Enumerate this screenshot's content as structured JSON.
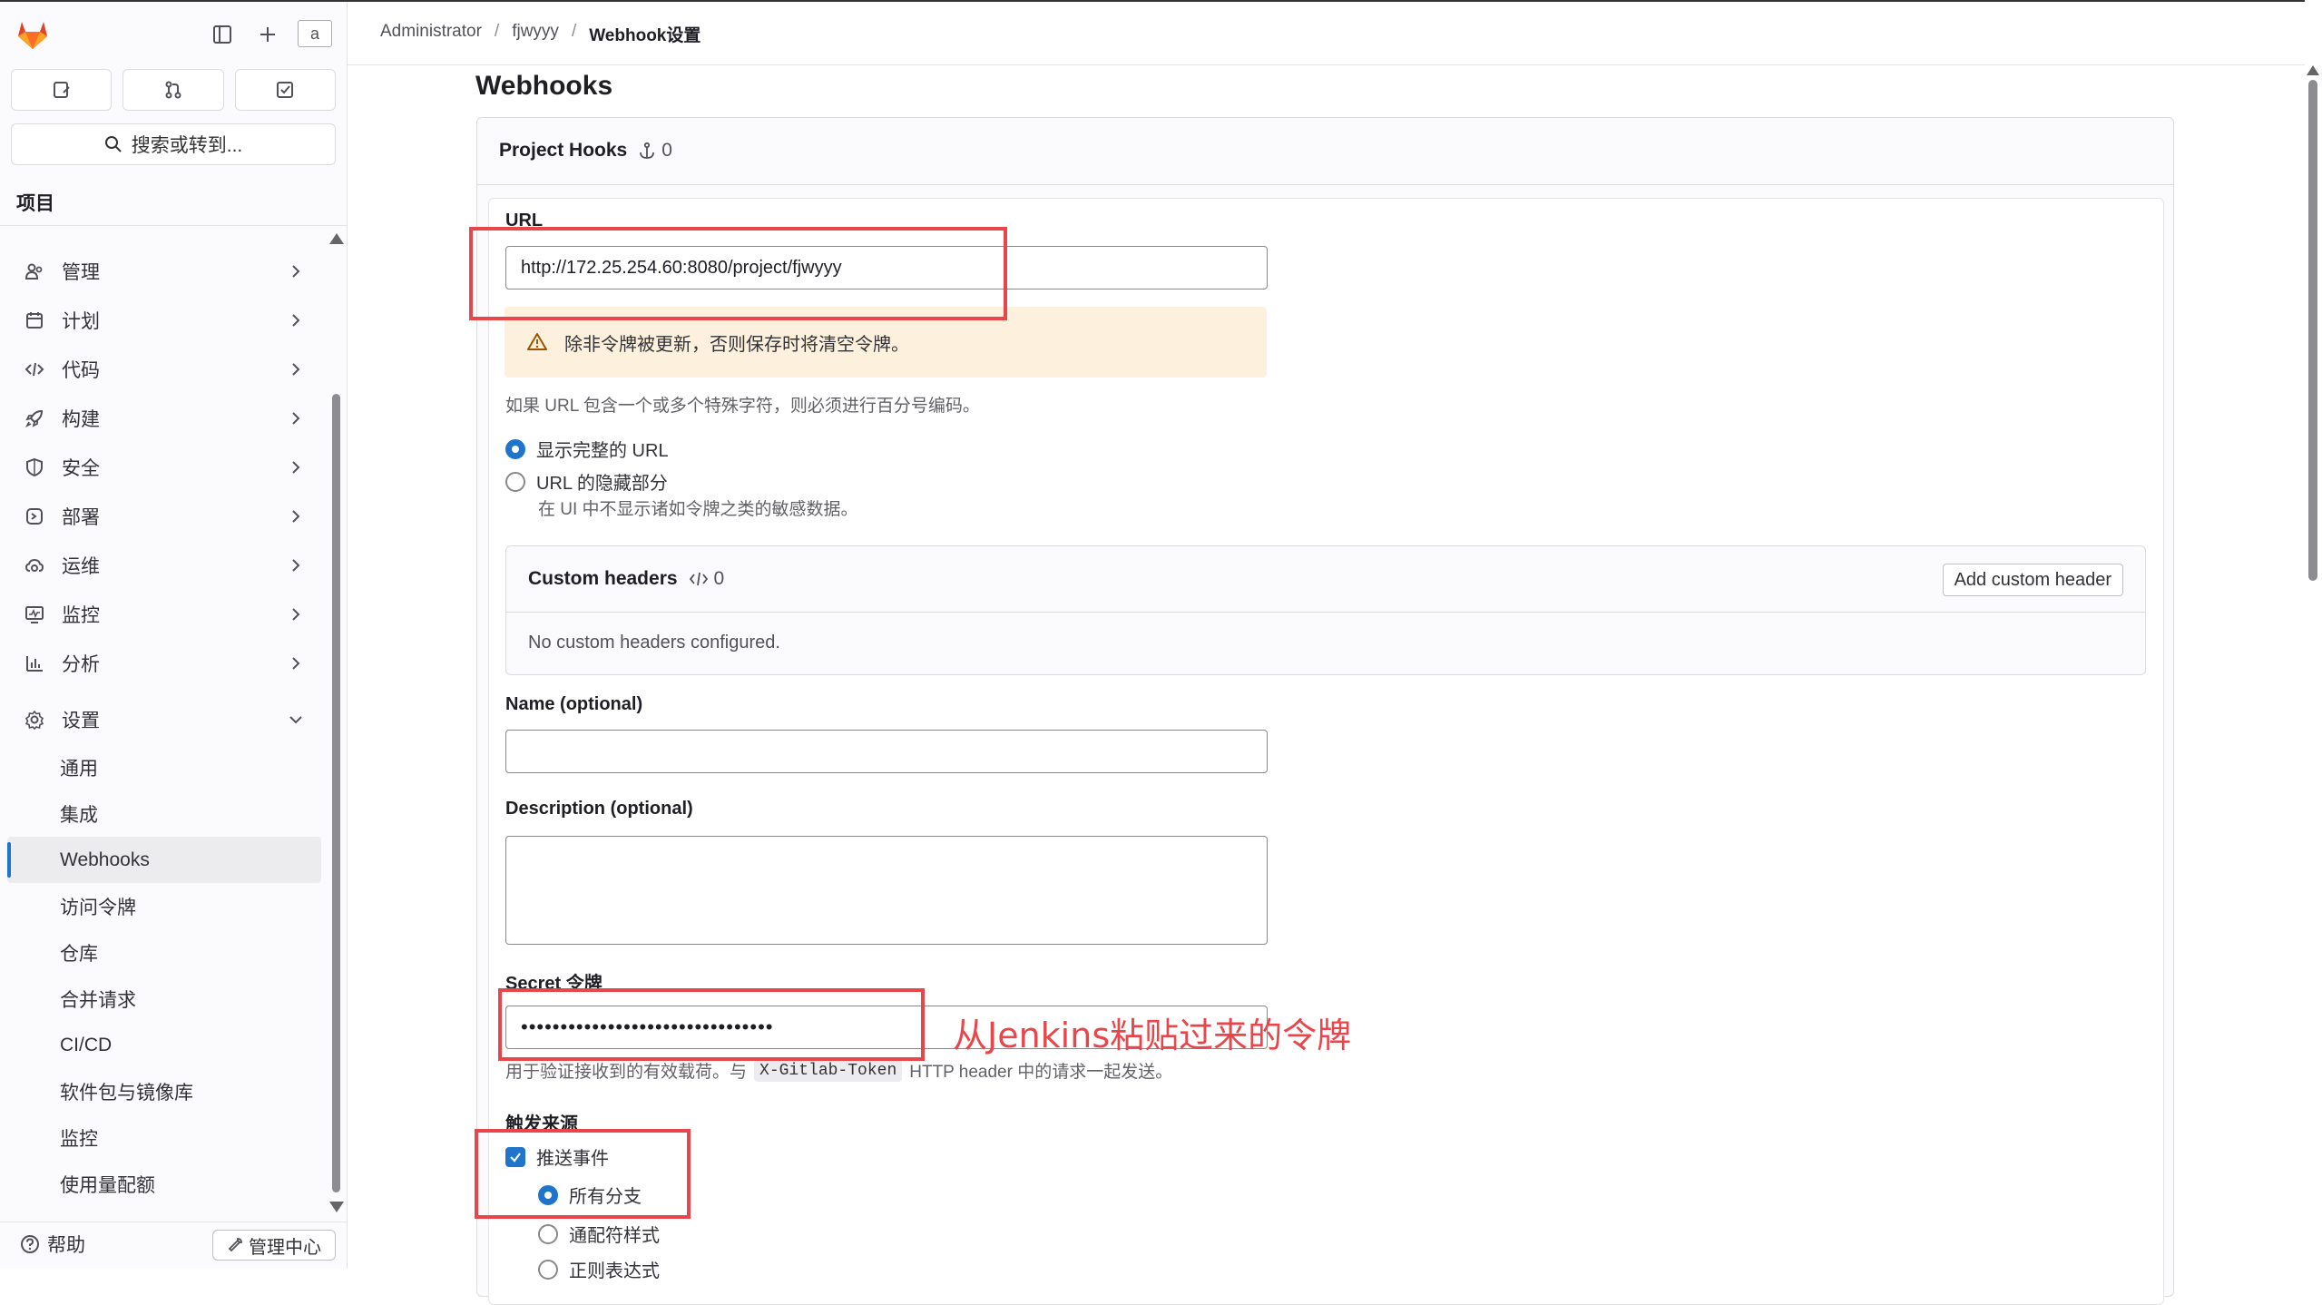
{
  "sidebar": {
    "search_label": "搜索或转到...",
    "avatar_alt": "a",
    "section_title": "项目",
    "menu": [
      {
        "label": "管理",
        "icon": "users-icon"
      },
      {
        "label": "计划",
        "icon": "calendar-icon"
      },
      {
        "label": "代码",
        "icon": "code-icon"
      },
      {
        "label": "构建",
        "icon": "rocket-icon"
      },
      {
        "label": "安全",
        "icon": "shield-icon"
      },
      {
        "label": "部署",
        "icon": "deploy-icon"
      },
      {
        "label": "运维",
        "icon": "cloud-icon"
      },
      {
        "label": "监控",
        "icon": "monitor-icon"
      },
      {
        "label": "分析",
        "icon": "chart-icon"
      },
      {
        "label": "设置",
        "icon": "gear-icon"
      }
    ],
    "settings_sub": [
      "通用",
      "集成",
      "Webhooks",
      "访问令牌",
      "仓库",
      "合并请求",
      "CI/CD",
      "软件包与镜像库",
      "监控",
      "使用量配额"
    ],
    "active_sub": "Webhooks",
    "help_label": "帮助",
    "admin_label": "管理中心"
  },
  "breadcrumb": {
    "items": [
      "Administrator",
      "fjwyyy",
      "Webhook设置"
    ]
  },
  "main": {
    "title": "Webhooks",
    "card_title": "Project Hooks",
    "hook_count": "0",
    "url_label": "URL",
    "url_value": "http://172.25.254.60:8080/project/fjwyyy",
    "warning_text": "除非令牌被更新，否则保存时将清空令牌。",
    "url_help": "如果 URL 包含一个或多个特殊字符，则必须进行百分号编码。",
    "radio_show_full": "显示完整的 URL",
    "radio_mask": "URL 的隐藏部分",
    "radio_mask_help": "在 UI 中不显示诸如令牌之类的敏感数据。",
    "custom_headers_title": "Custom headers",
    "custom_headers_count": "0",
    "add_custom_header": "Add custom header",
    "no_custom_headers": "No custom headers configured.",
    "name_label": "Name (optional)",
    "description_label": "Description (optional)",
    "secret_label": "Secret 令牌",
    "secret_value": "••••••••••••••••••••••••••••••••",
    "secret_help_prefix": "用于验证接收到的有效载荷。与",
    "secret_help_code": "X-Gitlab-Token",
    "secret_help_suffix": "HTTP header 中的请求一起发送。",
    "trigger_label": "触发来源",
    "push_events": "推送事件",
    "all_branches": "所有分支",
    "wildcard": "通配符样式",
    "regex": "正则表达式"
  },
  "annotation": {
    "text": "从Jenkins粘贴过来的令牌",
    "color": "#e8464b"
  },
  "colors": {
    "accent": "#1f75cb",
    "warning_bg": "#fdf1dd"
  }
}
